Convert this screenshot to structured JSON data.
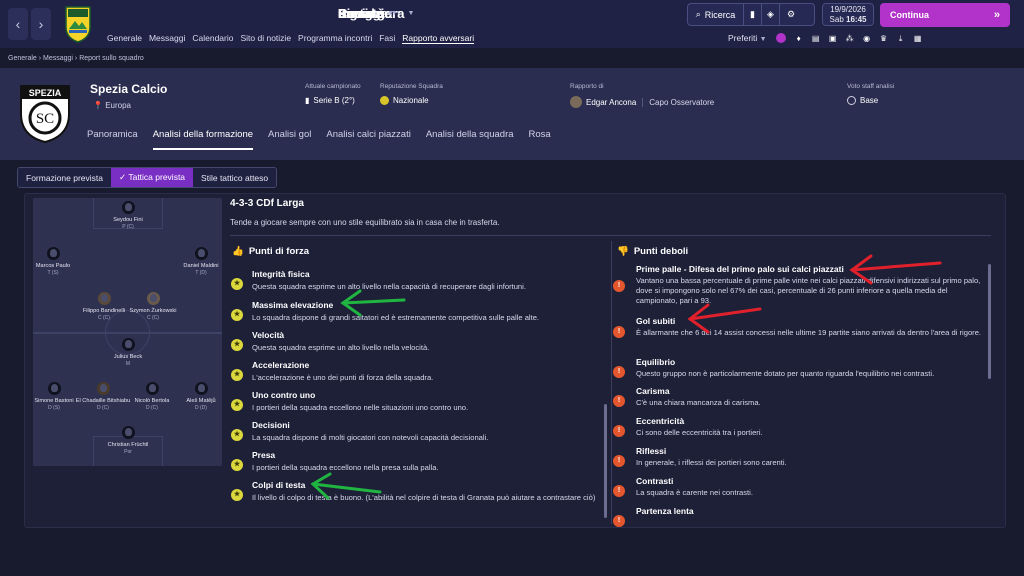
{
  "nav": {
    "back": "‹",
    "forward": "›",
    "main": [
      {
        "label": "Portale"
      },
      {
        "label": "Rosa"
      },
      {
        "label": "Ingaggio"
      },
      {
        "label": "Piano gara"
      },
      {
        "label": "Società"
      },
      {
        "label": "Carriera"
      }
    ],
    "sub": [
      "Generale",
      "Messaggi",
      "Calendario",
      "Sito di notizie",
      "Programma incontri",
      "Fasi",
      "Rapporto avversari"
    ]
  },
  "search": {
    "label": "Ricerca"
  },
  "date": {
    "day": "19/9/2026",
    "weekday": "Sab",
    "time": "16:45"
  },
  "continue": {
    "label": "Continua"
  },
  "prefs": {
    "label": "Preferiti"
  },
  "breadcrumb": "Generale  ›  Messaggi  ›  Report sullo squadro",
  "club": {
    "name": "Spezia Calcio",
    "region": "Europa",
    "crest_text": "SPEZIA",
    "crest_mono": "SC"
  },
  "info": {
    "league": {
      "label": "Attuale campionato",
      "value": "Serie B (2°)"
    },
    "reputation": {
      "label": "Reputazione Squadra",
      "value": "Nazionale"
    },
    "report": {
      "label": "Rapporto di",
      "value": "Edgar Ancona",
      "role": "Capo Osservatore"
    },
    "staff": {
      "label": "Voto staff analisi",
      "value": "Base"
    }
  },
  "tabs": [
    "Panoramica",
    "Analisi della formazione",
    "Analisi gol",
    "Analisi calci piazzati",
    "Analisi della squadra",
    "Rosa"
  ],
  "segments": [
    "Formazione prevista",
    "✓  Tattica prevista",
    "Stile tattico atteso"
  ],
  "formation": {
    "title": "4-3-3 CDf Larga",
    "description": "Tende a giocare sempre con uno stile equilibrato sia in casa che in trasferta."
  },
  "players": [
    {
      "name": "Seydou Fini",
      "pos": "P (C)"
    },
    {
      "name": "Marcos Paulo",
      "pos": "T (S)"
    },
    {
      "name": "Daniel Maldini",
      "pos": "T (D)"
    },
    {
      "name": "Filippo Bandinelli",
      "pos": "C (C)"
    },
    {
      "name": "Szymon Żurkowski",
      "pos": "C (C)"
    },
    {
      "name": "Julius Beck",
      "pos": "M"
    },
    {
      "name": "Simone Bastoni",
      "pos": "D (S)"
    },
    {
      "name": "El Chadaille Bitshiabu",
      "pos": "D (C)"
    },
    {
      "name": "Nicolò Bertola",
      "pos": "D (C)"
    },
    {
      "name": "Aleš Matějů",
      "pos": "D (D)"
    },
    {
      "name": "Christian Früchtl",
      "pos": "Por"
    }
  ],
  "strengths": {
    "title": "Punti di forza",
    "items": [
      {
        "title": "Integrità fisica",
        "desc": "Questa squadra esprime un alto livello nella capacità di recuperare dagli infortuni."
      },
      {
        "title": "Massima elevazione",
        "desc": "Lo squadra dispone di grandi saltatori ed è estremamente competitiva sulle palle alte."
      },
      {
        "title": "Velocità",
        "desc": "Questa squadra esprime un alto livello nella velocità."
      },
      {
        "title": "Accelerazione",
        "desc": "L'accelerazione è uno dei punti di forza della squadra."
      },
      {
        "title": "Uno contro uno",
        "desc": "I portieri della squadra eccellono nelle situazioni uno contro uno."
      },
      {
        "title": "Decisioni",
        "desc": "La squadra dispone di molti giocatori con notevoli capacità decisionali."
      },
      {
        "title": "Presa",
        "desc": "I portieri della squadra eccellono nella presa sulla palla."
      },
      {
        "title": "Colpi di testa",
        "desc": "Il livello di colpo di testa è buono. (L'abilità nel colpire di testa di Granata può aiutare a contrastare ciò)"
      }
    ]
  },
  "weaknesses": {
    "title": "Punti deboli",
    "items": [
      {
        "title": "Prime palle - Difesa del primo palo sui calci piazzati",
        "desc": "Vantano una bassa percentuale di prime palle vinte nei calci piazzati difensivi indirizzati sul primo palo, dove si impongono solo nel 67% dei casi, percentuale di 26 punti inferiore a quella media del campionato, pari a 93."
      },
      {
        "title": "Gol subiti",
        "desc": "È allarmante che 6 dei 14 assist concessi nelle ultime 19 partite siano arrivati da dentro l'area di rigore."
      },
      {
        "title": "Equilibrio",
        "desc": "Questo gruppo non è particolarmente dotato per quanto riguarda l'equilibrio nei contrasti."
      },
      {
        "title": "Carisma",
        "desc": "C'è una chiara mancanza di carisma."
      },
      {
        "title": "Eccentricità",
        "desc": "Ci sono delle eccentricità tra i portieri."
      },
      {
        "title": "Riflessi",
        "desc": "In generale, i riflessi dei portieri sono carenti."
      },
      {
        "title": "Contrasti",
        "desc": "La squadra è carente nei contrasti."
      },
      {
        "title": "Partenza lenta",
        "desc": ""
      }
    ]
  },
  "colors": {
    "accent": "#b233c9",
    "tab_active": "#7a2fc4",
    "strength_icon": "#dbd83c",
    "weakness_icon": "#e4572e",
    "arrow_red": "#e0202a",
    "arrow_green": "#1fb540"
  }
}
